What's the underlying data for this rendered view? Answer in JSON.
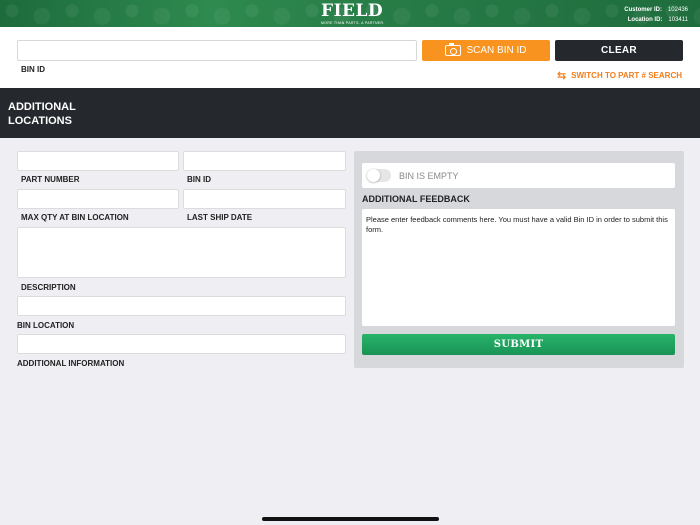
{
  "header": {
    "logo_text": "FIELD",
    "logo_tagline": "MORE THAN PARTS. A PARTNER.",
    "customer_id_label": "Customer ID:",
    "customer_id_value": "102436",
    "location_id_label": "Location ID:",
    "location_id_value": "103411",
    "brand_color": "#267a45"
  },
  "search": {
    "bin_id_value": "",
    "bin_id_label": "BIN ID",
    "scan_label": "SCAN BIN ID",
    "clear_label": "CLEAR",
    "switch_label": "SWITCH TO PART # SEARCH",
    "scan_color": "#f7931e",
    "link_color": "#f07d1a"
  },
  "section": {
    "title": "ADDITIONAL LOCATIONS"
  },
  "form": {
    "part_number_label": "PART NUMBER",
    "bin_id_label": "BIN ID",
    "max_qty_label": "MAX QTY AT BIN LOCATION",
    "last_ship_date_label": "LAST SHIP DATE",
    "description_label": "DESCRIPTION",
    "bin_location_label": "BIN LOCATION",
    "additional_info_label": "ADDITIONAL INFORMATION"
  },
  "feedback": {
    "bin_empty_label": "BIN IS EMPTY",
    "bin_empty_on": false,
    "title": "ADDITIONAL FEEDBACK",
    "placeholder": "Please enter feedback comments here. You must have a valid Bin ID in order to submit this form.",
    "submit_label": "SUBMIT",
    "submit_color": "#1fa35e"
  }
}
